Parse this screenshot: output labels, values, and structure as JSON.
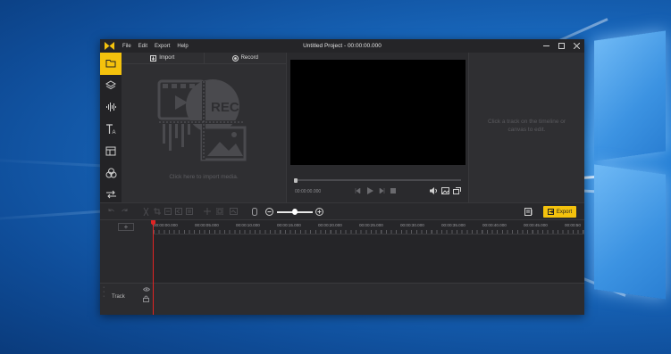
{
  "window": {
    "title": "Untitled Project - 00:00:00.000",
    "menu": [
      "File",
      "Edit",
      "Export",
      "Help"
    ]
  },
  "sidebar": {
    "items": [
      "media-icon",
      "layers-icon",
      "audio-icon",
      "text-icon",
      "template-icon",
      "filters-icon",
      "transitions-icon"
    ]
  },
  "media": {
    "import_label": "Import",
    "record_label": "Record",
    "art_label": "REC",
    "hint": "Click here to import media."
  },
  "preview": {
    "timecode": "00:00:00.000"
  },
  "properties": {
    "hint": "Click a track on the timeline or canvas to edit."
  },
  "toolbar": {
    "export_label": "Export"
  },
  "timeline": {
    "ruler_labels": [
      "00:00:00.000",
      "00:00:05.000",
      "00:00:10.000",
      "00:00:15.000",
      "00:00:20.000",
      "00:00:25.000",
      "00:00:30.000",
      "00:00:35.000",
      "00:00:40.000",
      "00:00:45.000",
      "00:00:50"
    ],
    "track_label": "Track"
  },
  "colors": {
    "accent": "#f4c20d",
    "playhead": "#e02424",
    "window_bg": "#2b2b2e"
  }
}
